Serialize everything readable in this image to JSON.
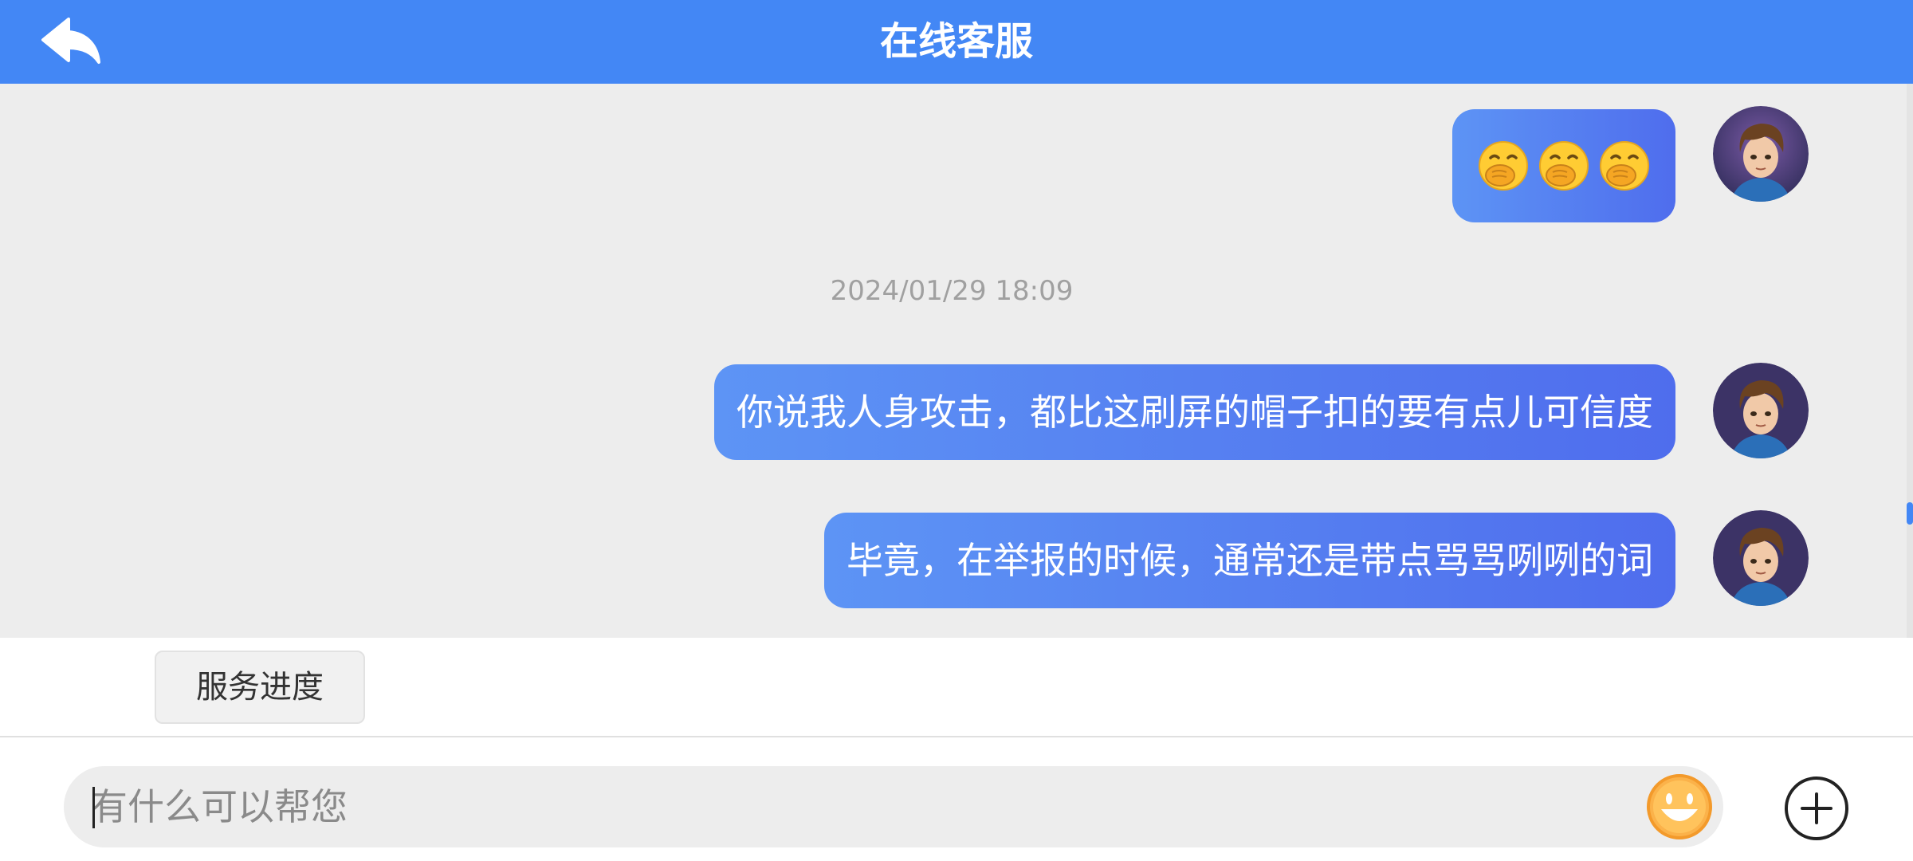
{
  "header": {
    "title": "在线客服",
    "back_icon": "back-arrow-icon",
    "bg_color": "#4387f5"
  },
  "chat": {
    "messages": [
      {
        "type": "emoji",
        "content": "🤭🤭🤭",
        "emoji_icon": "hand-over-mouth-emoji",
        "count": 3,
        "sender": "self"
      },
      {
        "type": "timestamp",
        "content": "2024/01/29 18:09"
      },
      {
        "type": "text",
        "content": "你说我人身攻击，都比这刷屏的帽子扣的要有点儿可信度",
        "sender": "self"
      },
      {
        "type": "text",
        "content": "毕竟，在举报的时候，通常还是带点骂骂咧咧的词",
        "sender": "self"
      }
    ],
    "bubble_gradient": [
      "#5d94f5",
      "#4f6ded"
    ]
  },
  "quick_actions": {
    "service_progress": "服务进度"
  },
  "input": {
    "placeholder": "有什么可以帮您",
    "value": "",
    "emoji_button_icon": "smiley-face-icon",
    "plus_button_icon": "plus-circle-icon",
    "emoji_color": "#f7a44a"
  }
}
